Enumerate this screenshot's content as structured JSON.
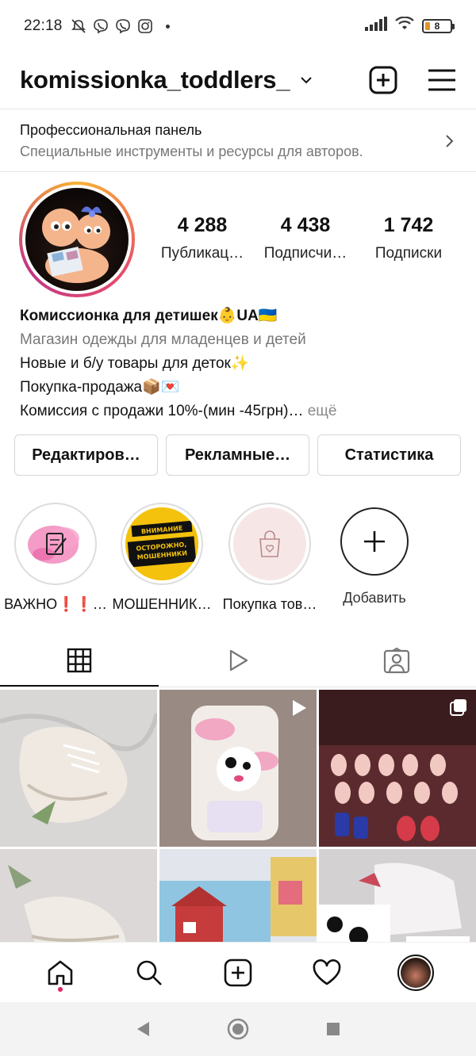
{
  "status_bar": {
    "time": "22:18",
    "battery": "8"
  },
  "header": {
    "username": "komissionka_toddlers_"
  },
  "pro_panel": {
    "title": "Профессиональная панель",
    "subtitle": "Специальные инструменты и ресурсы для авторов."
  },
  "stats": [
    {
      "value": "4 288",
      "label": "Публикац…"
    },
    {
      "value": "4 438",
      "label": "Подписчи…"
    },
    {
      "value": "1 742",
      "label": "Подписки"
    }
  ],
  "bio": {
    "name": "Комиссионка для детишек👶UA🇺🇦",
    "category": "Магазин одежды для младенцев и детей",
    "line1": "Новые и б/у товары для деток✨",
    "line2": "Покупка-продажа📦💌",
    "line3": "Комиссия с продажи 10%-(мин -45грн)…",
    "more": " ещё"
  },
  "buttons": {
    "edit": "Редактиров…",
    "ads": "Рекламные…",
    "stats": "Статистика"
  },
  "highlights": [
    {
      "label": "ВАЖНО❗❗…"
    },
    {
      "label": "МОШЕННИК…",
      "badge_top": "ВНИМАНИЕ",
      "badge_main": "ОСТОРОЖНО, МОШЕННИКИ"
    },
    {
      "label": "Покупка тов…"
    },
    {
      "label": "Добавить"
    }
  ]
}
